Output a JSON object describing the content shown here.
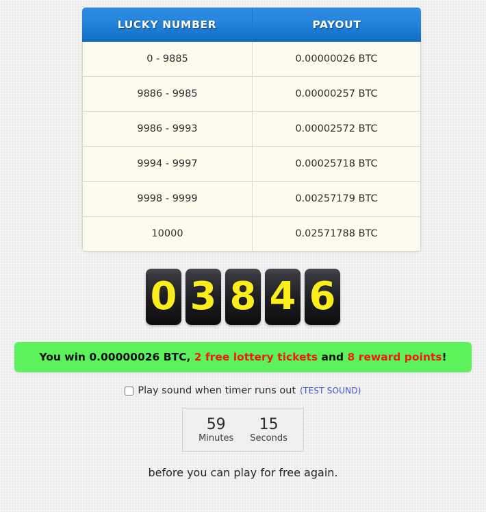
{
  "table": {
    "headers": [
      "LUCKY NUMBER",
      "PAYOUT"
    ],
    "rows": [
      {
        "number": "0 - 9885",
        "payout": "0.00000026 BTC"
      },
      {
        "number": "9886 - 9985",
        "payout": "0.00000257 BTC"
      },
      {
        "number": "9986 - 9993",
        "payout": "0.00002572 BTC"
      },
      {
        "number": "9994 - 9997",
        "payout": "0.00025718 BTC"
      },
      {
        "number": "9998 - 9999",
        "payout": "0.00257179 BTC"
      },
      {
        "number": "10000",
        "payout": "0.02571788 BTC"
      }
    ]
  },
  "roll": {
    "digits": [
      "0",
      "3",
      "8",
      "4",
      "6"
    ],
    "value": "03846"
  },
  "win": {
    "prefix": "You win 0.00000026 BTC, ",
    "tickets": "2 free lottery tickets",
    "conjunction": " and ",
    "points": "8 reward points",
    "suffix": "!",
    "amount": "0.00000026 BTC",
    "background_color": "#5cf25c",
    "highlight_color": "#ef1c10"
  },
  "sound": {
    "label": "Play sound when timer runs out",
    "test_link": "(TEST SOUND)",
    "checked": false,
    "link_color": "#3f51cf"
  },
  "timer": {
    "minutes_value": "59",
    "minutes_label": "Minutes",
    "seconds_value": "15",
    "seconds_label": "Seconds"
  },
  "footer": {
    "text": "before you can play for free again."
  }
}
